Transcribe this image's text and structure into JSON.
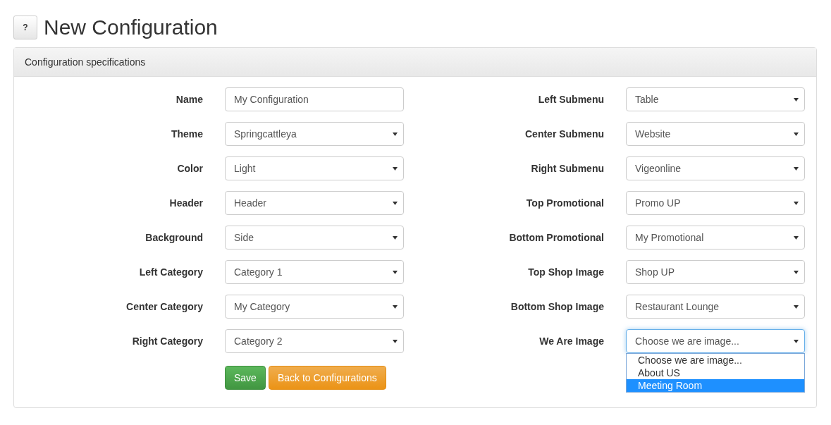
{
  "help_button": "?",
  "title": "New Configuration",
  "panel": {
    "heading": "Configuration specifications",
    "left_fields": [
      {
        "label": "Name",
        "kind": "text",
        "value": "My Configuration"
      },
      {
        "label": "Theme",
        "kind": "select",
        "value": "Springcattleya"
      },
      {
        "label": "Color",
        "kind": "select",
        "value": "Light"
      },
      {
        "label": "Header",
        "kind": "select",
        "value": "Header"
      },
      {
        "label": "Background",
        "kind": "select",
        "value": "Side"
      },
      {
        "label": "Left Category",
        "kind": "select",
        "value": "Category 1"
      },
      {
        "label": "Center Category",
        "kind": "select",
        "value": "My Category"
      },
      {
        "label": "Right Category",
        "kind": "select",
        "value": "Category 2"
      }
    ],
    "right_fields": [
      {
        "label": "Left Submenu",
        "kind": "select",
        "value": "Table"
      },
      {
        "label": "Center Submenu",
        "kind": "select",
        "value": "Website"
      },
      {
        "label": "Right Submenu",
        "kind": "select",
        "value": "Vigeonline"
      },
      {
        "label": "Top Promotional",
        "kind": "select",
        "value": "Promo UP"
      },
      {
        "label": "Bottom Promotional",
        "kind": "select",
        "value": "My Promotional"
      },
      {
        "label": "Top Shop Image",
        "kind": "select",
        "value": "Shop UP"
      },
      {
        "label": "Bottom Shop Image",
        "kind": "select",
        "value": "Restaurant Lounge"
      },
      {
        "label": "We Are Image",
        "kind": "select",
        "value": "Choose we are image...",
        "open": true,
        "options": [
          {
            "label": "Choose we are image...",
            "highlighted": false
          },
          {
            "label": "About US",
            "highlighted": false
          },
          {
            "label": "Meeting Room",
            "highlighted": true
          }
        ]
      }
    ],
    "buttons": [
      {
        "label": "Save",
        "kind": "primary"
      },
      {
        "label": "Back to Configurations",
        "kind": "warning"
      }
    ]
  }
}
